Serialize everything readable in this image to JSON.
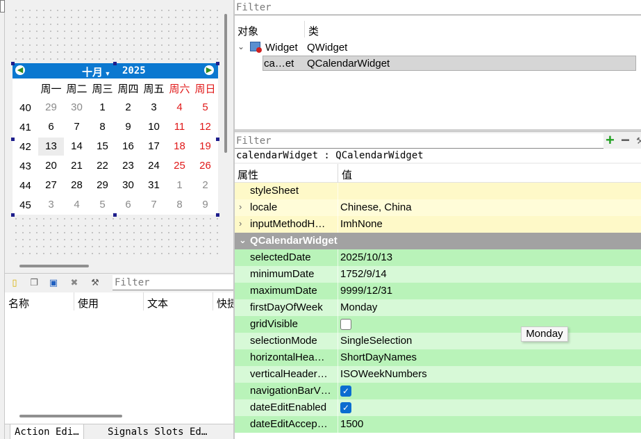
{
  "calendar": {
    "month": "十月",
    "year": "2025",
    "day_headers": [
      "周一",
      "周二",
      "周三",
      "周四",
      "周五",
      "周六",
      "周日"
    ],
    "weeks": [
      {
        "week": "40",
        "days": [
          "29",
          "30",
          "1",
          "2",
          "3",
          "4",
          "5"
        ]
      },
      {
        "week": "41",
        "days": [
          "6",
          "7",
          "8",
          "9",
          "10",
          "11",
          "12"
        ]
      },
      {
        "week": "42",
        "days": [
          "13",
          "14",
          "15",
          "16",
          "17",
          "18",
          "19"
        ]
      },
      {
        "week": "43",
        "days": [
          "20",
          "21",
          "22",
          "23",
          "24",
          "25",
          "26"
        ]
      },
      {
        "week": "44",
        "days": [
          "27",
          "28",
          "29",
          "30",
          "31",
          "1",
          "2"
        ]
      },
      {
        "week": "45",
        "days": [
          "3",
          "4",
          "5",
          "6",
          "7",
          "8",
          "9"
        ]
      }
    ],
    "selected": "13"
  },
  "widget_box": {
    "filter_placeholder": "Filter",
    "columns": [
      "名称",
      "使用",
      "文本",
      "快捷"
    ],
    "tabs": [
      "Action Edi…",
      "Signals Slots Ed…"
    ]
  },
  "object_inspector": {
    "filter_placeholder": "Filter",
    "columns": [
      "对象",
      "类"
    ],
    "rows": [
      {
        "name": "Widget",
        "class": "QWidget"
      },
      {
        "name": "ca…et",
        "class": "QCalendarWidget"
      }
    ]
  },
  "property_editor": {
    "filter_placeholder": "Filter",
    "title": "calendarWidget : QCalendarWidget",
    "columns": [
      "属性",
      "值"
    ],
    "rows": [
      {
        "name": "styleSheet",
        "value": ""
      },
      {
        "name": "locale",
        "value": "Chinese, China"
      },
      {
        "name": "inputMethodH…",
        "value": "ImhNone"
      },
      {
        "name": "QCalendarWidget",
        "value": ""
      },
      {
        "name": "selectedDate",
        "value": "2025/10/13"
      },
      {
        "name": "minimumDate",
        "value": "1752/9/14"
      },
      {
        "name": "maximumDate",
        "value": "9999/12/31"
      },
      {
        "name": "firstDayOfWeek",
        "value": "Monday"
      },
      {
        "name": "gridVisible",
        "value": ""
      },
      {
        "name": "selectionMode",
        "value": "SingleSelection"
      },
      {
        "name": "horizontalHea…",
        "value": "ShortDayNames"
      },
      {
        "name": "verticalHeader…",
        "value": "ISOWeekNumbers"
      },
      {
        "name": "navigationBarV…",
        "value": ""
      },
      {
        "name": "dateEditEnabled",
        "value": ""
      },
      {
        "name": "dateEditAccep…",
        "value": "1500"
      }
    ]
  },
  "tooltip": "Monday"
}
